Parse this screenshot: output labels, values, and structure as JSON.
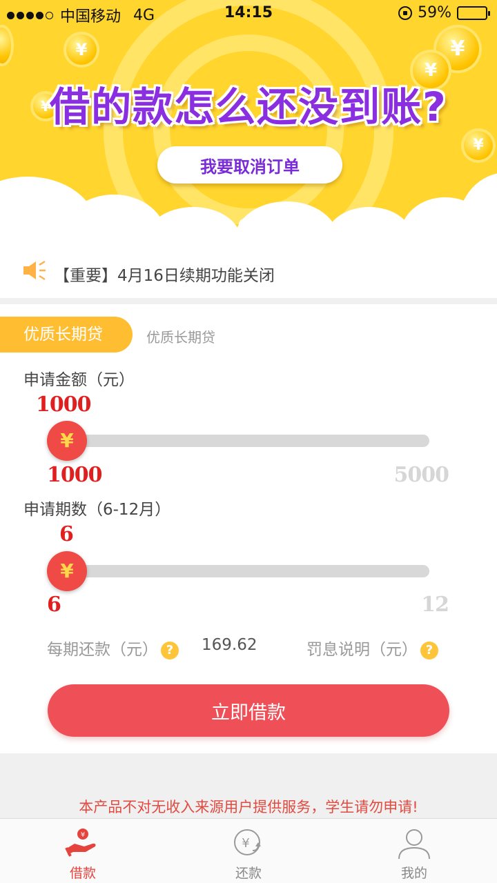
{
  "status_bar": {
    "carrier": "中国移动",
    "network": "4G",
    "time": "14:15",
    "battery": "59%",
    "battery_level": 0.59
  },
  "banner": {
    "headline": "借的款怎么还没到账?",
    "button_label": "我要取消订单",
    "pages": 2,
    "active_page": 0
  },
  "notice": {
    "text": "【重要】4月16日续期功能关闭"
  },
  "loan": {
    "product_tag": "优质长期贷",
    "product_subtitle": "优质长期贷",
    "amount": {
      "label": "申请金额（元）",
      "current": "1000",
      "min": "1000",
      "max": "5000",
      "level": 0
    },
    "period": {
      "label": "申请期数（6-12月）",
      "current": "6",
      "min": "6",
      "max": "12",
      "level": 0
    },
    "per_period_label": "每期还款（元）",
    "per_period_value": "169.62",
    "penalty_label": "罚息说明（元）",
    "help_symbol": "?",
    "thumb_symbol": "¥",
    "submit_label": "立即借款"
  },
  "disclaimer": "本产品不对无收入来源用户提供服务，学生请勿申请!",
  "tabs": [
    {
      "label": "借款",
      "icon": "hand-coin-icon",
      "active": true
    },
    {
      "label": "还款",
      "icon": "yen-refresh-icon",
      "active": false
    },
    {
      "label": "我的",
      "icon": "user-icon",
      "active": false
    }
  ],
  "colors": {
    "accent_red": "#ef5058",
    "banner_yellow": "#ffd52e",
    "tag_orange": "#ffbe32",
    "headline_purple": "#8a2fe0"
  }
}
